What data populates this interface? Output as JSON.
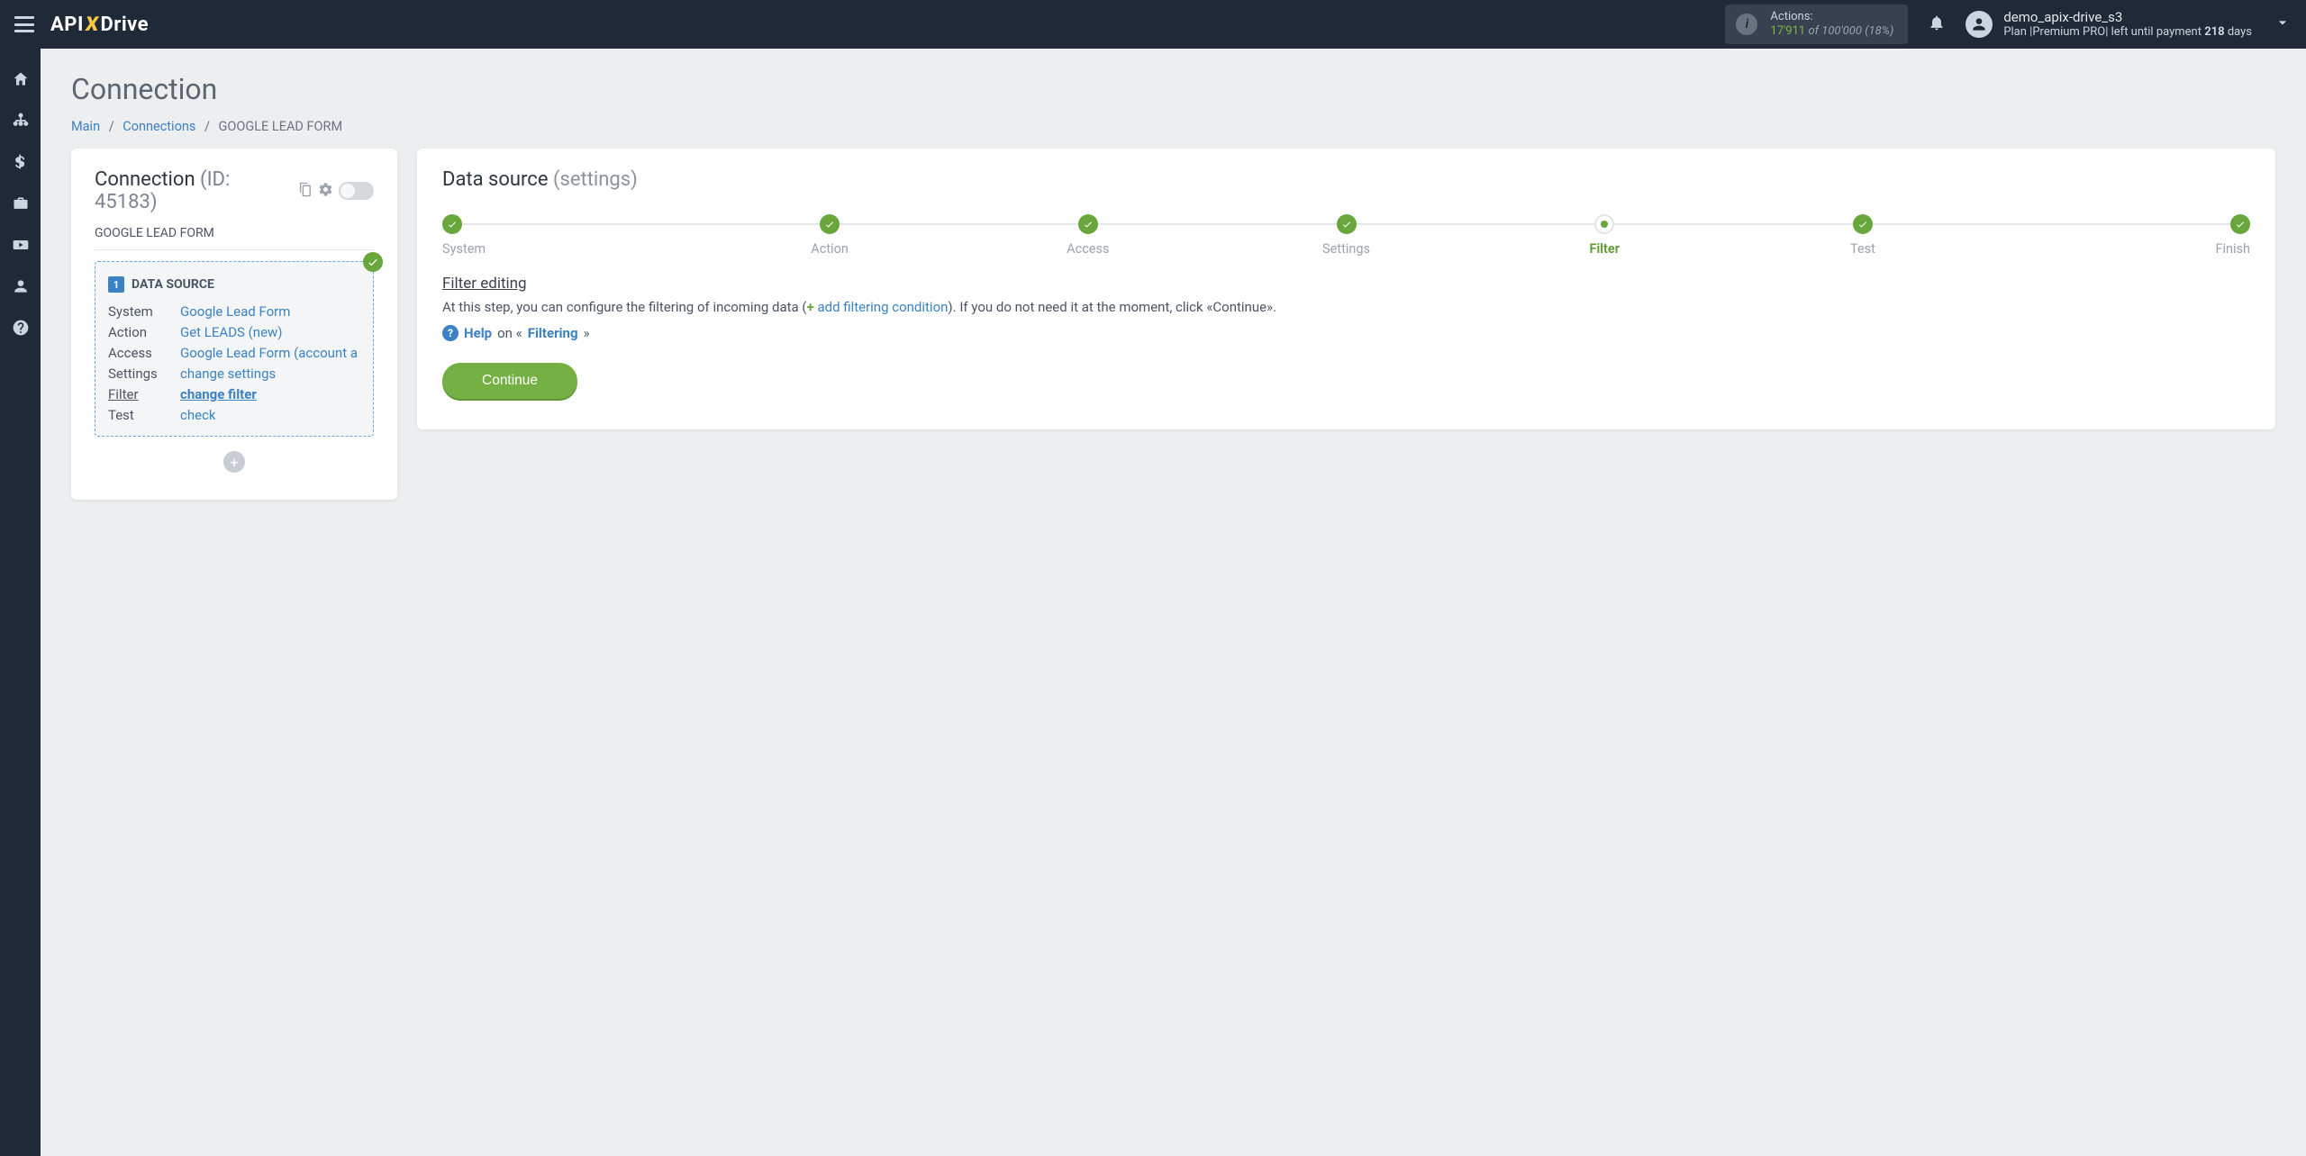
{
  "topbar": {
    "logo_api": "API",
    "logo_x": "X",
    "logo_drive": "Drive",
    "actions_label": "Actions:",
    "actions_used": "17'911",
    "actions_of": "of",
    "actions_total": "100'000",
    "actions_pct": "(18%)",
    "user_name": "demo_apix-drive_s3",
    "plan_prefix": "Plan |",
    "plan_name": "Premium PRO",
    "plan_mid": "| left until payment ",
    "plan_days": "218",
    "plan_suffix": " days"
  },
  "page": {
    "title": "Connection",
    "breadcrumb_main": "Main",
    "breadcrumb_connections": "Connections",
    "breadcrumb_current": "GOOGLE LEAD FORM"
  },
  "conn_card": {
    "title_prefix": "Connection ",
    "id_label": "(ID: 45183)",
    "subtitle": "GOOGLE LEAD FORM",
    "section_title": "DATA SOURCE",
    "rows": {
      "system_k": "System",
      "system_v": "Google Lead Form",
      "action_k": "Action",
      "action_v": "Get LEADS (new)",
      "access_k": "Access",
      "access_v": "Google Lead Form (account a",
      "settings_k": "Settings",
      "settings_v": "change settings",
      "filter_k": "Filter",
      "filter_v": "change filter",
      "test_k": "Test",
      "test_v": "check"
    }
  },
  "right": {
    "title_main": "Data source ",
    "title_grey": "(settings)",
    "steps": [
      "System",
      "Action",
      "Access",
      "Settings",
      "Filter",
      "Test",
      "Finish"
    ],
    "active_step_index": 4,
    "section_heading": "Filter editing",
    "p_before": "At this step, you can configure the filtering of incoming data (",
    "add_cond": "add filtering condition",
    "p_after": "). If you do not need it at the moment, click «Continue».",
    "help_word": "Help",
    "help_on": " on «",
    "help_topic": "Filtering",
    "help_close": "»",
    "continue_btn": "Continue"
  }
}
